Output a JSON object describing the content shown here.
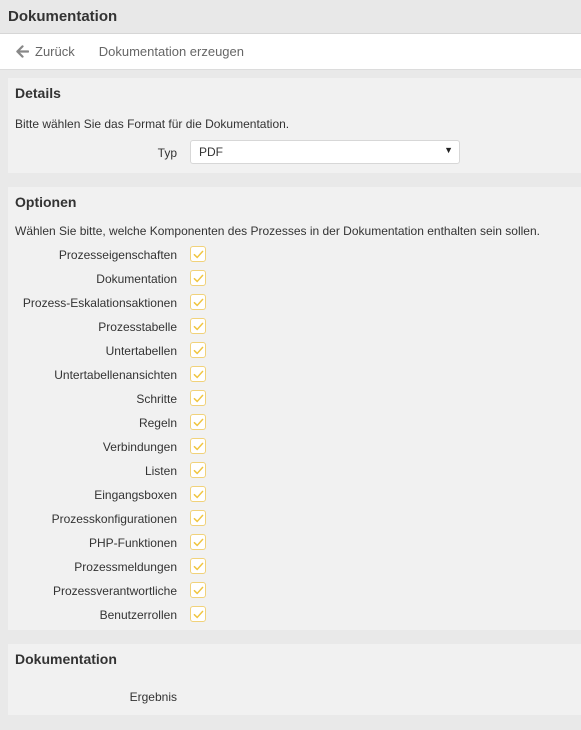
{
  "window": {
    "title": "Dokumentation"
  },
  "toolbar": {
    "back_label": "Zurück",
    "generate_label": "Dokumentation erzeugen"
  },
  "details": {
    "title": "Details",
    "description": "Bitte wählen Sie das Format für die Dokumentation.",
    "type_label": "Typ",
    "type_value": "PDF"
  },
  "options": {
    "title": "Optionen",
    "description": "Wählen Sie bitte, welche Komponenten des Prozesses in der Dokumentation enthalten sein sollen.",
    "items": [
      {
        "label": "Prozesseigenschaften",
        "checked": true
      },
      {
        "label": "Dokumentation",
        "checked": true
      },
      {
        "label": "Prozess-Eskalationsaktionen",
        "checked": true
      },
      {
        "label": "Prozesstabelle",
        "checked": true
      },
      {
        "label": "Untertabellen",
        "checked": true
      },
      {
        "label": "Untertabellenansichten",
        "checked": true
      },
      {
        "label": "Schritte",
        "checked": true
      },
      {
        "label": "Regeln",
        "checked": true
      },
      {
        "label": "Verbindungen",
        "checked": true
      },
      {
        "label": "Listen",
        "checked": true
      },
      {
        "label": "Eingangsboxen",
        "checked": true
      },
      {
        "label": "Prozesskonfigurationen",
        "checked": true
      },
      {
        "label": "PHP-Funktionen",
        "checked": true
      },
      {
        "label": "Prozessmeldungen",
        "checked": true
      },
      {
        "label": "Prozessverantwortliche",
        "checked": true
      },
      {
        "label": "Benutzerrollen",
        "checked": true
      }
    ]
  },
  "documentation": {
    "title": "Dokumentation",
    "result_label": "Ergebnis"
  },
  "colors": {
    "checkbox_border": "#f1d27a",
    "checkmark": "#f0c540",
    "panel_bg": "#f1f1f1",
    "page_bg": "#e9e9e9"
  }
}
